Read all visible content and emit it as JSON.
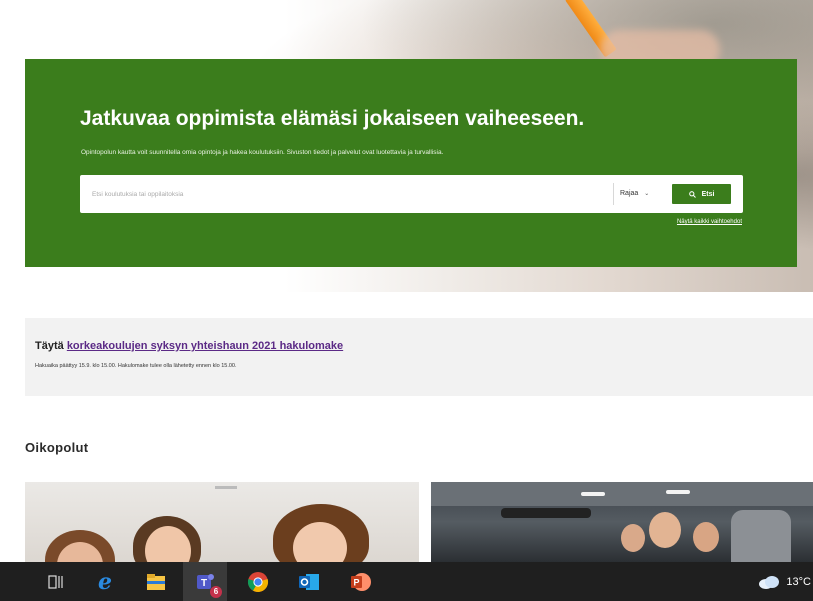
{
  "hero": {
    "title": "Jatkuvaa oppimista elämäsi jokaiseen vaiheeseen.",
    "subtitle": "Opintopolun kautta voit suunnitella omia opintoja ja hakea koulutuksiin. Sivuston tiedot ja palvelut ovat luotettavia ja turvallisia.",
    "search_placeholder": "Etsi koulutuksia tai oppilaitoksia",
    "search_value": "",
    "filter_label": "Rajaa",
    "search_button_label": "Etsi",
    "show_all_link": "Näytä kaikki vaihtoehdot",
    "accent_color": "#3b7d1c"
  },
  "notice": {
    "prefix": "Täytä",
    "link_text": "korkeakoulujen syksyn yhteishaun 2021 hakulomake",
    "description": "Hakuaika päättyy 15.9. klo 15.00. Hakulomake tulee olla lähetetty ennen klo 15.00."
  },
  "shortcuts": {
    "title": "Oikopolut"
  },
  "taskbar": {
    "apps": [
      "task-view-icon",
      "internet-explorer-icon",
      "file-explorer-icon",
      "teams-icon",
      "chrome-icon",
      "outlook-icon",
      "powerpoint-icon"
    ],
    "teams_badge": "6",
    "weather_temp": "13°C"
  }
}
